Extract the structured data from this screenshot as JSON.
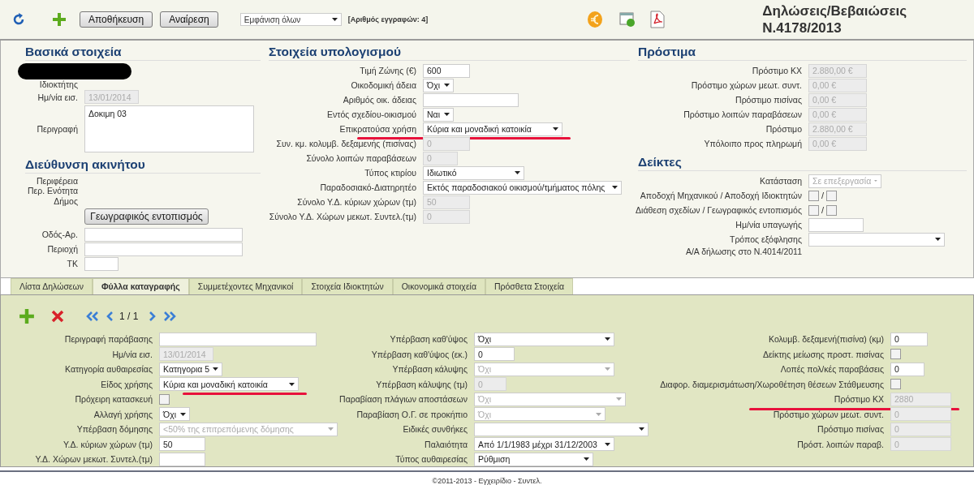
{
  "toolbar": {
    "buttons": [
      "Αποθήκευση",
      "Αναίρεση"
    ],
    "filter": "Εμφάνιση όλων",
    "count": "[Αριθμός εγγραφών: 4]",
    "title": "Δηλώσεις/Βεβαιώσεις\nN.4178/2013"
  },
  "top_columns": [
    {
      "sections": [
        {
          "title": "Βασικά στοιχεία",
          "fields": [
            {
              "kind": "redaction"
            },
            {
              "kind": "label",
              "label": "Ιδιοκτήτης"
            },
            {
              "kind": "text",
              "label": "Ημ/νία εισ.",
              "value": "13/01/2014",
              "disabled": true
            },
            {
              "kind": "textarea",
              "label": "Περιγραφή",
              "value": "Δοκιμη 03"
            }
          ]
        },
        {
          "title": "Διεύθυνση ακινήτου",
          "fields": [
            {
              "kind": "label",
              "label": "Περιφέρεια"
            },
            {
              "kind": "label",
              "label": "Περ. Ενότητα"
            },
            {
              "kind": "label",
              "label": "Δήμος"
            },
            {
              "kind": "button",
              "value": "Γεωγραφικός εντοπισμός"
            },
            {
              "kind": "text",
              "label": "Οδός-Αρ.",
              "disabled": false
            },
            {
              "kind": "text",
              "label": "Περιοχή",
              "disabled": false
            },
            {
              "kind": "text",
              "label": "ΤΚ",
              "disabled": false
            }
          ]
        }
      ]
    },
    {
      "sections": [
        {
          "title": "Στοιχεία υπολογισμού",
          "fields": [
            {
              "kind": "text",
              "label": "Τιμή Ζώνης (€)",
              "value": "600",
              "disabled": false
            },
            {
              "kind": "select",
              "label": "Οικοδομική άδεια",
              "value": "Όχι",
              "disabled": false
            },
            {
              "kind": "text",
              "label": "Αριθμός οικ. άδειας",
              "disabled": false
            },
            {
              "kind": "select",
              "label": "Εντός σχεδίου-οικισμού",
              "value": "Ναι",
              "disabled": false
            },
            {
              "kind": "select",
              "label": "Επικρατούσα χρήση",
              "value": "Κύρια και μοναδική κατοικία",
              "disabled": false,
              "highlighted": true
            },
            {
              "kind": "text",
              "label": "Συν. κμ. κολυμβ. δεξαμενής (πισίνας)",
              "value": "0",
              "disabled": true
            },
            {
              "kind": "text",
              "label": "Σύνολο λοιπών παραβάσεων",
              "value": "0",
              "disabled": true
            },
            {
              "kind": "select",
              "label": "Τύπος κτιρίου",
              "value": "Ιδιωτικό",
              "disabled": false
            },
            {
              "kind": "select",
              "label": "Παραδοσιακό-Διατηρητέο",
              "value": "Εκτός παραδοσιακού οικισμού/τμήματος πόλης",
              "disabled": false
            },
            {
              "kind": "text",
              "label": "Σύνολο Υ.Δ. κύριων χώρων (τμ)",
              "value": "50",
              "disabled": true
            },
            {
              "kind": "text",
              "label": "Σύνολο Υ.Δ. Χώρων μεκωτ. Συντελ.(τμ)",
              "value": "0",
              "disabled": true
            }
          ]
        }
      ]
    },
    {
      "sections": [
        {
          "title": "Πρόστιμα",
          "fields": [
            {
              "kind": "text",
              "label": "Πρόστιμο ΚΧ",
              "value": "2.880,00 €",
              "disabled": true
            },
            {
              "kind": "text",
              "label": "Πρόστιμο χώρων μεωτ. συντ.",
              "value": "0,00 €",
              "disabled": true
            },
            {
              "kind": "text",
              "label": "Πρόστιμο πισίνας",
              "value": "0,00 €",
              "disabled": true
            },
            {
              "kind": "text",
              "label": "Πρόστιμο λοιπών παραβάσεων",
              "value": "0,00 €",
              "disabled": true
            },
            {
              "kind": "text",
              "label": "Πρόστιμο",
              "value": "2.880,00 €",
              "disabled": true
            },
            {
              "kind": "text",
              "label": "Υπόλοιπο προς πληρωμή",
              "value": "0,00 €",
              "disabled": true
            }
          ]
        },
        {
          "title": "Δείκτες",
          "fields": [
            {
              "kind": "select",
              "label": "Κατάσταση",
              "value": "Σε επεξεργασία",
              "disabled": true
            },
            {
              "kind": "checkpair",
              "label": "Αποδοχή Μηχανικού / Αποδοχή Ιδιοκτητών",
              "separator": "/",
              "checks": [
                false,
                false
              ]
            },
            {
              "kind": "checkpair",
              "label": "Διάθεση σχεδίων / Γεωγραφικός εντοπισμός",
              "separator": "/",
              "checks": [
                false,
                false
              ]
            },
            {
              "kind": "text",
              "label": "Ημ/νία υπαγωγής",
              "disabled": false
            },
            {
              "kind": "select",
              "label": "Τρόπος εξόφλησης",
              "disabled": false
            },
            {
              "kind": "label",
              "label": "Α/Α δήλωσης στο N.4014/2011"
            }
          ]
        }
      ]
    }
  ],
  "tabs": [
    {
      "label": "Λίστα Δηλώσεων",
      "selected": false
    },
    {
      "label": "Φύλλα καταγραφής",
      "selected": true
    },
    {
      "label": "Συμμετέχοντες Μηχανικοί",
      "selected": false
    },
    {
      "label": "Στοιχεία Ιδιοκτητών",
      "selected": false
    },
    {
      "label": "Οικονομικά στοιχεία",
      "selected": false
    },
    {
      "label": "Πρόσθετα Στοιχεία",
      "selected": false
    }
  ],
  "record_nav": {
    "position": "1 / 1"
  },
  "tab_columns": [
    {
      "fields": [
        {
          "kind": "text",
          "label": "Περιγραφή παράβασης",
          "disabled": false
        },
        {
          "kind": "text",
          "label": "Ημ/νία εισ.",
          "value": "13/01/2014",
          "disabled": true
        },
        {
          "kind": "select",
          "label": "Κατηγορία αυθαιρεσίας",
          "value": "Κατηγορια 5",
          "disabled": false
        },
        {
          "kind": "select",
          "label": "Είδος χρήσης",
          "value": "Κύρια και μοναδική κατοικία",
          "disabled": false,
          "highlighted": true
        },
        {
          "kind": "checkbox",
          "label": "Πρόχειρη κατασκευή",
          "checked": false
        },
        {
          "kind": "select",
          "label": "Αλλαγή χρήσης",
          "value": "Όχι",
          "disabled": false
        },
        {
          "kind": "select",
          "label": "Υπέρβαση δόμησης",
          "value": "<50% της επιτρεπόμενης δόμησης",
          "disabled": true
        },
        {
          "kind": "text",
          "label": "Υ.Δ. κύριων χώρων (τμ)",
          "value": "50",
          "disabled": false
        },
        {
          "kind": "text",
          "label": "Υ.Δ. Χώρων μεκωτ. Συντελ.(τμ)",
          "disabled": false
        }
      ]
    },
    {
      "fields": [
        {
          "kind": "select",
          "label": "Υπέρβαση καθ'ύψος",
          "value": "Όχι",
          "disabled": false
        },
        {
          "kind": "text",
          "label": "Υπέρβαση καθ'ύψος (εκ.)",
          "value": "0",
          "disabled": false
        },
        {
          "kind": "select",
          "label": "Υπέρβαση κάλυψης",
          "value": "Όχι",
          "disabled": true
        },
        {
          "kind": "text",
          "label": "Υπέρβαση κάλυψης (τμ)",
          "value": "0",
          "disabled": true
        },
        {
          "kind": "select",
          "label": "Παραβίαση πλάγιων αποστάσεων",
          "value": "Όχι",
          "disabled": true
        },
        {
          "kind": "select",
          "label": "Παραβίαση Ο.Γ. σε προκήπιο",
          "value": "Όχι",
          "disabled": true
        },
        {
          "kind": "select",
          "label": "Ειδικές συνθήκες",
          "disabled": false
        },
        {
          "kind": "select",
          "label": "Παλαιότητα",
          "value": "Από 1/1/1983 μέχρι 31/12/2003",
          "disabled": false
        },
        {
          "kind": "select",
          "label": "Τύπος αυθαιρεσίας",
          "value": "Ρύθμιση",
          "disabled": false
        }
      ]
    },
    {
      "fields": [
        {
          "kind": "text",
          "label": "Κολυμβ. δεξαμενή(πισίνα) (κμ)",
          "value": "0",
          "disabled": false
        },
        {
          "kind": "checkbox",
          "label": "Δείκτης μείωσης προστ. πισίνας",
          "checked": false
        },
        {
          "kind": "text",
          "label": "Λοπές πολ/κές παραβάσεις",
          "value": "0",
          "disabled": false
        },
        {
          "kind": "checkbox",
          "label": "Διαφορ. διαμερισμάτωση/Χωροθέτηση θέσεων Στάθμευσης",
          "checked": false
        },
        {
          "kind": "text",
          "label": "Πρόστιμο ΚΧ",
          "value": "2880",
          "disabled": true,
          "highlighted": true
        },
        {
          "kind": "text",
          "label": "Πρόστιμο χώρων μεωτ. συντ.",
          "value": "0",
          "disabled": true
        },
        {
          "kind": "text",
          "label": "Πρόστιμο πισίνας",
          "value": "0",
          "disabled": true
        },
        {
          "kind": "text",
          "label": "Πρόστ. λοιπών παραβ.",
          "value": "0",
          "disabled": true
        }
      ]
    }
  ],
  "footer": "©2011-2013 - Εγχειρίδιο - Συντελ."
}
